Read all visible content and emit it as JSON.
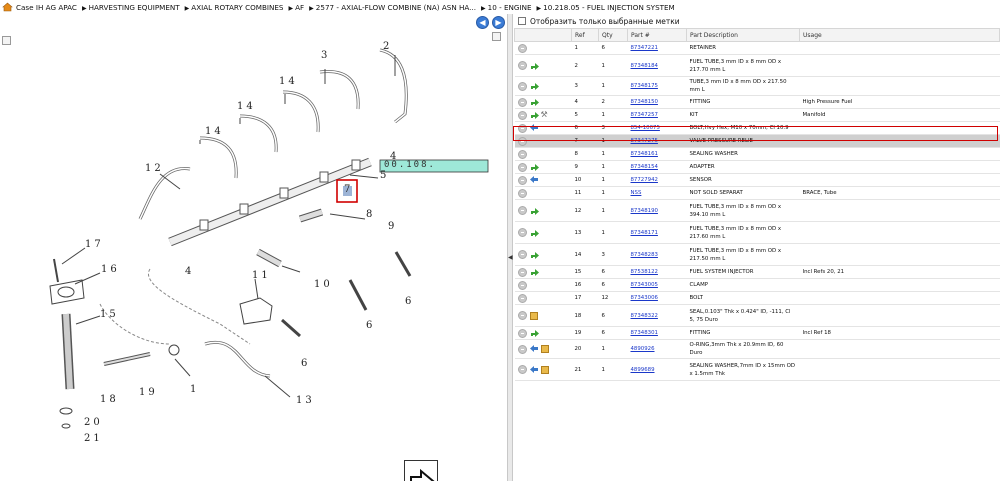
{
  "breadcrumb": [
    "Case IH AG APAC",
    "HARVESTING EQUIPMENT",
    "AXIAL ROTARY COMBINES",
    "AF",
    "2577 - AXIAL-FLOW COMBINE (NA) ASN HA...",
    "10 - ENGINE",
    "10.218.05 - FUEL INJECTION SYSTEM"
  ],
  "diagram": {
    "callouts": [
      "1",
      "2",
      "3",
      "4",
      "5",
      "6",
      "7",
      "8",
      "9",
      "10",
      "11",
      "12",
      "13",
      "14",
      "15",
      "16",
      "17",
      "18",
      "19",
      "20",
      "21"
    ],
    "selected_ref": "7",
    "bar_label": "00.108."
  },
  "parts_panel": {
    "filter_label": "Отобразить только выбранные метки",
    "columns": [
      "",
      "Ref",
      "Qty",
      "Part #",
      "Part Description",
      "Usage"
    ],
    "rows": [
      {
        "ref": "1",
        "qty": "6",
        "pn": "87347221",
        "desc": "RETAINER",
        "usage": "",
        "icons": []
      },
      {
        "ref": "2",
        "qty": "1",
        "pn": "87348184",
        "desc": "FUEL TUBE,3 mm ID x 8 mm OD x 217.70 mm L",
        "usage": "",
        "icons": [
          "green"
        ]
      },
      {
        "ref": "3",
        "qty": "1",
        "pn": "87348175",
        "desc": "TUBE,3 mm ID x 8 mm OD x 217.50 mm L",
        "usage": "",
        "icons": [
          "green"
        ]
      },
      {
        "ref": "4",
        "qty": "2",
        "pn": "87348150",
        "desc": "FITTING",
        "usage": "High Pressure Fuel",
        "icons": [
          "green"
        ]
      },
      {
        "ref": "5",
        "qty": "1",
        "pn": "87347257",
        "desc": "KIT",
        "usage": "Manifold",
        "icons": [
          "green",
          "wrench"
        ]
      },
      {
        "ref": "6",
        "qty": "3",
        "pn": "854-10075",
        "desc": "BOLT,Hvy Hex, M10 x 70mm, Cl 10.9",
        "usage": "",
        "icons": [
          "blue"
        ]
      },
      {
        "ref": "7",
        "qty": "1",
        "pn": "87347275",
        "desc": "VALVE PRESSURE RELIE",
        "usage": "",
        "icons": [],
        "selected": true
      },
      {
        "ref": "8",
        "qty": "1",
        "pn": "87348161",
        "desc": "SEALING WASHER",
        "usage": "",
        "icons": []
      },
      {
        "ref": "9",
        "qty": "1",
        "pn": "87348154",
        "desc": "ADAPTER",
        "usage": "",
        "icons": [
          "green"
        ]
      },
      {
        "ref": "10",
        "qty": "1",
        "pn": "87727942",
        "desc": "SENSOR",
        "usage": "",
        "icons": [
          "blue"
        ]
      },
      {
        "ref": "11",
        "qty": "1",
        "pn": "NSS",
        "desc": "NOT SOLD SEPARAT",
        "usage": "BRACE, Tube",
        "icons": []
      },
      {
        "ref": "12",
        "qty": "1",
        "pn": "87348190",
        "desc": "FUEL TUBE,3 mm ID x 8 mm OD x 394.10 mm L",
        "usage": "",
        "icons": [
          "green"
        ]
      },
      {
        "ref": "13",
        "qty": "1",
        "pn": "87348171",
        "desc": "FUEL TUBE,3 mm ID x 8 mm OD x 217.60 mm L",
        "usage": "",
        "icons": [
          "green"
        ]
      },
      {
        "ref": "14",
        "qty": "3",
        "pn": "87348283",
        "desc": "FUEL TUBE,3 mm ID x 8 mm OD x 217.50 mm L",
        "usage": "",
        "icons": [
          "green"
        ]
      },
      {
        "ref": "15",
        "qty": "6",
        "pn": "87538122",
        "desc": "FUEL SYSTEM INJECTOR",
        "usage": "Incl Refs 20, 21",
        "icons": [
          "green"
        ]
      },
      {
        "ref": "16",
        "qty": "6",
        "pn": "87343005",
        "desc": "CLAMP",
        "usage": "",
        "icons": []
      },
      {
        "ref": "17",
        "qty": "12",
        "pn": "87343006",
        "desc": "BOLT",
        "usage": "",
        "icons": []
      },
      {
        "ref": "18",
        "qty": "6",
        "pn": "87348322",
        "desc": "SEAL,0.103\" Thk x 0.424\" ID, -111, Cl 5, 75 Duro",
        "usage": "",
        "icons": [
          "note"
        ]
      },
      {
        "ref": "19",
        "qty": "6",
        "pn": "87348301",
        "desc": "FITTING",
        "usage": "Incl Ref 18",
        "icons": [
          "green"
        ]
      },
      {
        "ref": "20",
        "qty": "1",
        "pn": "4890926",
        "desc": "O-RING,3mm Thk x 20.9mm ID, 60 Duro",
        "usage": "",
        "icons": [
          "blue",
          "note"
        ]
      },
      {
        "ref": "21",
        "qty": "1",
        "pn": "4899689",
        "desc": "SEALING WASHER,7mm ID x 15mm OD x 1.5mm Thk",
        "usage": "",
        "icons": [
          "blue",
          "note"
        ]
      }
    ]
  }
}
